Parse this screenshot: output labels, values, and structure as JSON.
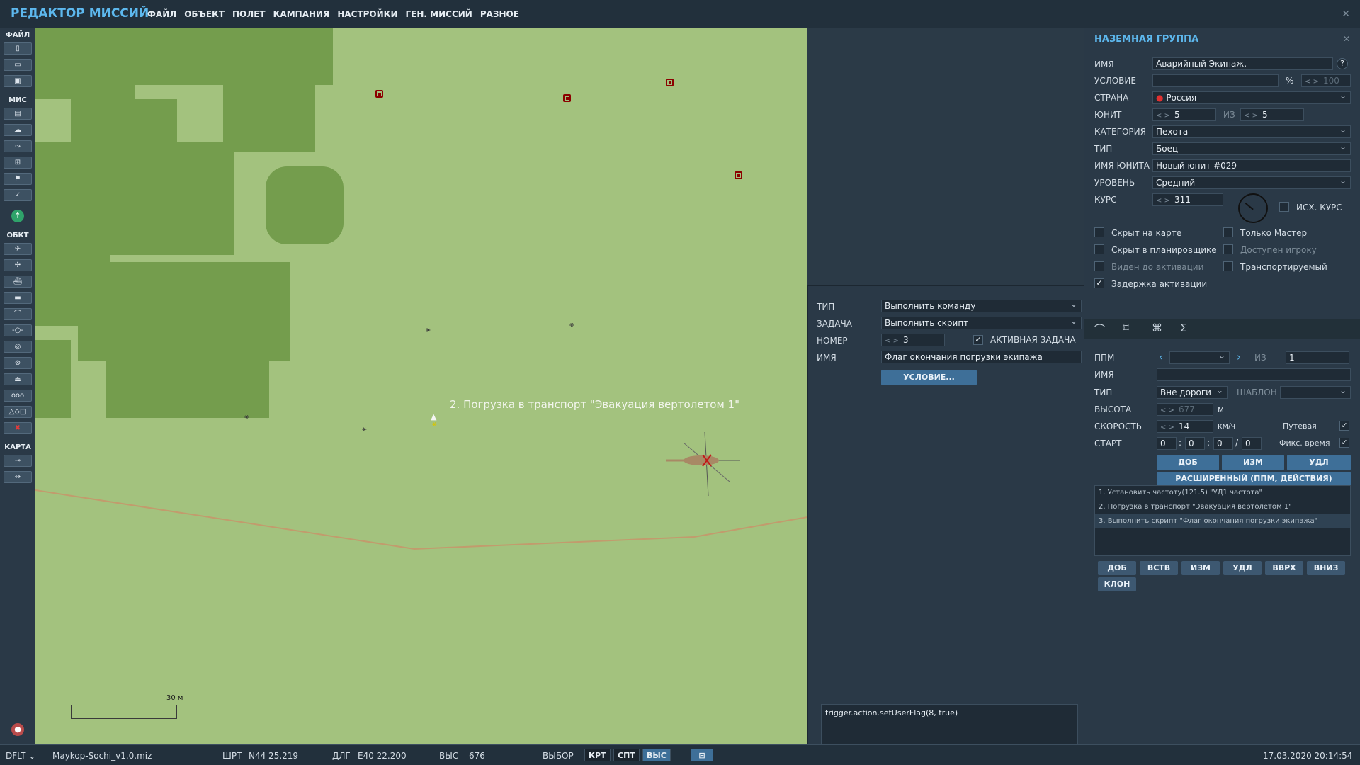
{
  "app_title": "РЕДАКТОР МИССИЙ",
  "menu": [
    "ФАЙЛ",
    "ОБЪЕКТ",
    "ПОЛЕТ",
    "КАМПАНИЯ",
    "НАСТРОЙКИ",
    "ГЕН. МИССИЙ",
    "РАЗНОЕ"
  ],
  "left_toolbar": {
    "section_file": "ФАЙЛ",
    "section_mission": "МИС",
    "section_objects": "ОБКТ",
    "section_map": "КАРТА",
    "icons": [
      "new-file-icon",
      "open-folder-icon",
      "save-icon",
      "briefing-icon",
      "weather-icon",
      "route-icon",
      "target-icon",
      "flag-icon",
      "check-icon",
      "plane-icon",
      "helicopter-icon",
      "ship-icon",
      "vehicle-icon",
      "tank-icon",
      "static-icon",
      "zone-icon",
      "radar-icon",
      "boat-icon",
      "cargo-icon",
      "shapes-icon",
      "delete-icon",
      "ruler-icon",
      "measure-icon"
    ]
  },
  "map": {
    "waypoint_label": "2. Погрузка в транспорт \"Эвакуация вертолетом 1\"",
    "scale_label": "30 м"
  },
  "task_panel": {
    "type_label": "ТИП",
    "type_value": "Выполнить команду",
    "task_label": "ЗАДАЧА",
    "task_value": "Выполнить скрипт",
    "number_label": "НОМЕР",
    "number_value": "3",
    "active_label": "АКТИВНАЯ ЗАДАЧА",
    "name_label": "ИМЯ",
    "name_value": "Флаг окончания погрузки экипажа",
    "condition_button": "УСЛОВИЕ...",
    "script": "trigger.action.setUserFlag(8, true)"
  },
  "group_panel": {
    "title": "НАЗЕМНАЯ ГРУППА",
    "help": "?",
    "name_label": "ИМЯ",
    "name_value": "Аварийный Экипаж.",
    "condition_label": "УСЛОВИЕ",
    "condition_pct": "%",
    "condition_value": "100",
    "country_label": "СТРАНА",
    "country_value": "Россия",
    "unit_label": "ЮНИТ",
    "unit_value": "5",
    "of_label": "ИЗ",
    "unit_total": "5",
    "category_label": "КАТЕГОРИЯ",
    "category_value": "Пехота",
    "type_label": "ТИП",
    "type_value": "Боец",
    "unitname_label": "ИМЯ ЮНИТА",
    "unitname_value": "Новый юнит #029",
    "level_label": "УРОВЕНЬ",
    "level_value": "Средний",
    "course_label": "КУРС",
    "course_value": "311",
    "init_course_label": "ИСХ. КУРС",
    "checkboxes": {
      "hidden_map": "Скрыт на карте",
      "master_only": "Только Мастер",
      "hidden_planner": "Скрыт в планировщике",
      "player_avail": "Доступен игроку",
      "visible_before": "Виден до активации",
      "transportable": "Транспортируемый",
      "delay": "Задержка активации"
    }
  },
  "waypoint_panel": {
    "tab_icons": [
      "route-tab-icon",
      "triggers-tab-icon",
      "payload-tab-icon",
      "summary-tab-icon"
    ],
    "ppm_label": "ППМ",
    "of_label": "ИЗ",
    "ppm_total": "1",
    "name_label": "ИМЯ",
    "type_label": "ТИП",
    "type_value": "Вне дороги",
    "template_label": "ШАБЛОН",
    "alt_label": "ВЫСОТА",
    "alt_value": "677",
    "alt_unit": "м",
    "speed_label": "СКОРОСТЬ",
    "speed_value": "14",
    "speed_unit": "км/ч",
    "path_speed": "Путевая",
    "start_label": "СТАРТ",
    "start_h": "0",
    "start_m": "0",
    "start_s": "0",
    "start_d": "0",
    "fixed_time": "Фикс. время",
    "btn_add": "ДОБ",
    "btn_edit": "ИЗМ",
    "btn_del": "УДЛ",
    "advanced": "РАСШИРЕННЫЙ (ППМ, ДЕЙСТВИЯ)",
    "actions": [
      "1. Установить частоту(121.5) \"УД1 частота\"",
      "2. Погрузка в транспорт \"Эвакуация вертолетом 1\"",
      "3. Выполнить скрипт \"Флаг окончания погрузки экипажа\""
    ],
    "action_buttons": [
      "ДОБ",
      "ВСТВ",
      "ИЗМ",
      "УДЛ",
      "ВВРХ",
      "ВНИЗ"
    ],
    "clone_button": "КЛОН"
  },
  "status_bar": {
    "profile": "DFLT",
    "file": "Maykop-Sochi_v1.0.miz",
    "lat_label": "ШРТ",
    "lat_value": "N44 25.219",
    "lon_label": "ДЛГ",
    "lon_value": "E40 22.200",
    "alt_label": "ВЫС",
    "alt_value": "676",
    "select_label": "ВЫБОР",
    "modes": [
      "КРТ",
      "СПТ",
      "ВЫС"
    ],
    "datetime": "17.03.2020 20:14:54"
  },
  "colors": {
    "accent": "#5db8ee",
    "map_bg": "#a3c27e",
    "forest": "#749d4d",
    "marker": "#8b0000",
    "button": "#3e6f98"
  }
}
